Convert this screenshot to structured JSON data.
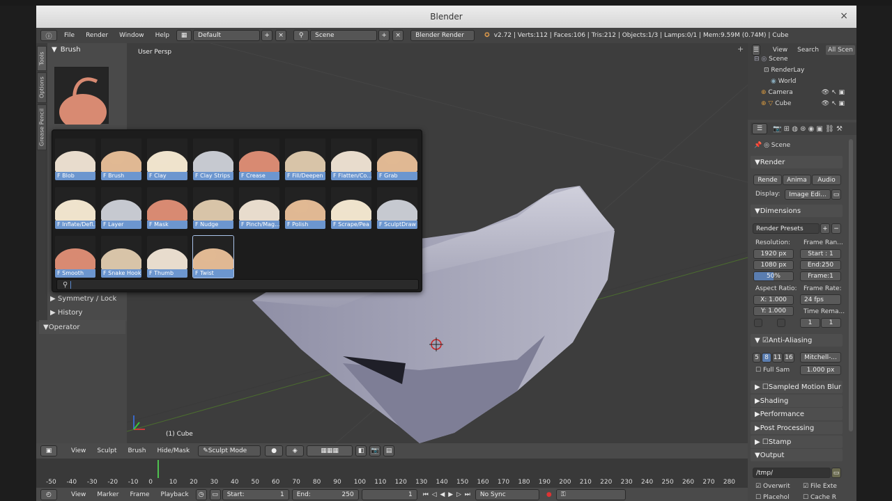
{
  "window": {
    "title": "Blender",
    "close": "×"
  },
  "menu": {
    "items": [
      "File",
      "Render",
      "Window",
      "Help"
    ],
    "layout": "Default",
    "scene": "Scene",
    "engine": "Blender Render",
    "stats": "v2.72 | Verts:112 | Faces:106 | Tris:212 | Objects:1/3 | Lamps:0/1 | Mem:9.59M (0.74M) | Cube"
  },
  "toolshelf": {
    "tabs": [
      "Tools",
      "Options",
      "Grease Pencil"
    ],
    "brush_panel": "Brush",
    "symmetry": "Symmetry / Lock",
    "history": "History",
    "operator": "Operator"
  },
  "viewport": {
    "label": "User Persp",
    "object": "(1) Cube"
  },
  "brushes": [
    {
      "label": "F Blob",
      "icon": "blob-icon"
    },
    {
      "label": "F Brush",
      "icon": "brush-icon"
    },
    {
      "label": "F Clay",
      "icon": "clay-icon"
    },
    {
      "label": "F Clay Strips",
      "icon": "clay-strips-icon"
    },
    {
      "label": "F Crease",
      "icon": "crease-icon"
    },
    {
      "label": "F Fill/Deepen",
      "icon": "fill-icon"
    },
    {
      "label": "F Flatten/Co...",
      "icon": "flatten-icon"
    },
    {
      "label": "F Grab",
      "icon": "grab-icon"
    },
    {
      "label": "F Inflate/Defl...",
      "icon": "inflate-icon"
    },
    {
      "label": "F Layer",
      "icon": "layer-icon"
    },
    {
      "label": "F Mask",
      "icon": "mask-icon"
    },
    {
      "label": "F Nudge",
      "icon": "nudge-icon"
    },
    {
      "label": "F Pinch/Mag...",
      "icon": "pinch-icon"
    },
    {
      "label": "F Polish",
      "icon": "polish-icon"
    },
    {
      "label": "F Scrape/Pea",
      "icon": "scrape-icon"
    },
    {
      "label": "F SculptDraw",
      "icon": "sculptdraw-icon"
    },
    {
      "label": "F Smooth",
      "icon": "smooth-icon"
    },
    {
      "label": "F Snake Hook",
      "icon": "snake-hook-icon"
    },
    {
      "label": "F Thumb",
      "icon": "thumb-icon"
    },
    {
      "label": "F Twist",
      "icon": "twist-icon"
    }
  ],
  "outliner": {
    "view": "View",
    "search": "Search",
    "all": "All Scen",
    "items": [
      "Scene",
      "RenderLay",
      "World",
      "Camera",
      "Cube"
    ]
  },
  "props": {
    "scene": "Scene",
    "render": "Render",
    "render_btn": "Rende",
    "anim_btn": "Anima",
    "audio_btn": "Audio",
    "display_label": "Display:",
    "display_val": "Image Edi...",
    "dimensions": "Dimensions",
    "presets": "Render Presets",
    "resolution": "Resolution:",
    "res_x": "1920 px",
    "res_y": "1080 px",
    "res_pct": "50%",
    "frame_range": "Frame Ran...",
    "start": "Start : 1",
    "end": "End:250",
    "frame": "Frame:1",
    "aspect": "Aspect Ratio:",
    "ax": "X: 1.000",
    "ay": "Y: 1.000",
    "frame_rate": "Frame Rate:",
    "fps": "24 fps",
    "time_remap": "Time Rema...",
    "remap_old": "1",
    "remap_new": "1",
    "aa": "Anti-Aliasing",
    "aa_samples": [
      "5",
      "8",
      "11",
      "16"
    ],
    "aa_filter": "Mitchell-...",
    "full_sample": "Full Sam",
    "filter_size": "1.000 px",
    "motion_blur": "Sampled Motion Blur",
    "shading": "Shading",
    "performance": "Performance",
    "post": "Post Processing",
    "stamp": "Stamp",
    "output": "Output",
    "output_path": "/tmp/",
    "overwrite": "Overwrit",
    "file_ext": "File Exte",
    "placeholders": "Placehol",
    "cache": "Cache R"
  },
  "vp_header": {
    "view": "View",
    "sculpt": "Sculpt",
    "brush": "Brush",
    "hidemask": "Hide/Mask",
    "mode": "Sculpt Mode"
  },
  "timeline": {
    "ticks": [
      "-50",
      "-40",
      "-30",
      "-20",
      "-10",
      "0",
      "10",
      "20",
      "30",
      "40",
      "50",
      "60",
      "70",
      "80",
      "90",
      "100",
      "110",
      "120",
      "130",
      "140",
      "150",
      "160",
      "170",
      "180",
      "190",
      "200",
      "210",
      "220",
      "230",
      "240",
      "250",
      "260",
      "270",
      "280"
    ]
  },
  "tl_header": {
    "view": "View",
    "marker": "Marker",
    "frame": "Frame",
    "playback": "Playback",
    "start": "Start:",
    "start_val": "1",
    "end": "End:",
    "end_val": "250",
    "current": "1",
    "sync": "No Sync"
  }
}
